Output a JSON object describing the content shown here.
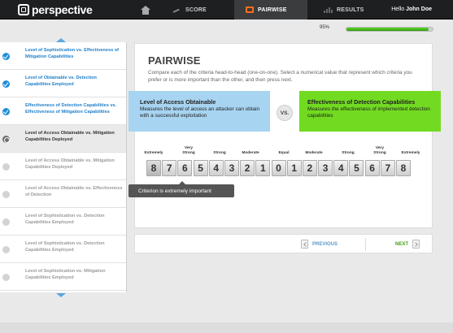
{
  "app": {
    "name": "perspective",
    "greeting": "Hello",
    "user": "John Doe"
  },
  "nav": {
    "tabs": [
      {
        "label": "SCORE"
      },
      {
        "label": "PAIRWISE",
        "active": true
      },
      {
        "label": "RESULTS"
      }
    ]
  },
  "progress": {
    "label": "95%",
    "value": 0.95
  },
  "sidebar": {
    "items": [
      {
        "label": "Level of Sophistication vs. Effectiveness of Mitigation Capabilities",
        "state": "done"
      },
      {
        "label": "Level of Obtainable vs. Detection Capabilities Employed",
        "state": "done"
      },
      {
        "label": "Effectiveness of Detection Capabilities vs. Effectiveness of Mitigation Capabilities",
        "state": "done"
      },
      {
        "label": "Level of Access Obtainable vs. Mitigation Capabilities Deployed",
        "state": "current"
      },
      {
        "label": "Level of Access Obtainable vs. Mitigation Capabilities Deployed",
        "state": "todo"
      },
      {
        "label": "Level of Access Obtainable vs. Effectiveness of Detection",
        "state": "todo"
      },
      {
        "label": "Level of Sophistication vs. Detection Capabilities Employed",
        "state": "todo"
      },
      {
        "label": "Level of Sophistication vs. Detection Capabilities Employed",
        "state": "todo"
      },
      {
        "label": "Level of Sophistication vs. Mitigation Capabilities Employed",
        "state": "todo"
      }
    ]
  },
  "main": {
    "title": "PAIRWISE",
    "description": "Compare each of the criteria head-to-head (one-on-one). Select a numerical value that represent which criteria you prefer or is more important than the other, and then press next.",
    "left_criterion": {
      "title": "Level of Access Obtainable",
      "description": "Measures the level of access an attacker can obtain with a successful exploitation"
    },
    "vs": "VS.",
    "right_criterion": {
      "title": "Effectiveness of Detection Capabilities",
      "description": "Measures the effectiveness of implemented detection capabilities"
    },
    "scale_labels": {
      "extremely_l": "Extremely",
      "very_strong_l": "Very Strong",
      "strong_l": "Strong",
      "moderate_l": "Moderate",
      "equal": "Equal",
      "moderate_r": "Moderate",
      "strong_r": "Strong",
      "very_strong_r": "Very Strong",
      "extremely_r": "Extremely"
    },
    "scale_values": [
      "8",
      "7",
      "6",
      "5",
      "4",
      "3",
      "2",
      "1",
      "0",
      "1",
      "2",
      "3",
      "4",
      "5",
      "6",
      "7",
      "8"
    ],
    "selected_index": 0,
    "tooltip": "Criterion is extremely important"
  },
  "footer_nav": {
    "previous": "PREVIOUS",
    "next": "NEXT"
  },
  "colors": {
    "accent_blue": "#1f8ed8",
    "accent_green": "#72db21",
    "left_criterion": "#a7d4f1",
    "active_tab_icon": "#f37021"
  }
}
